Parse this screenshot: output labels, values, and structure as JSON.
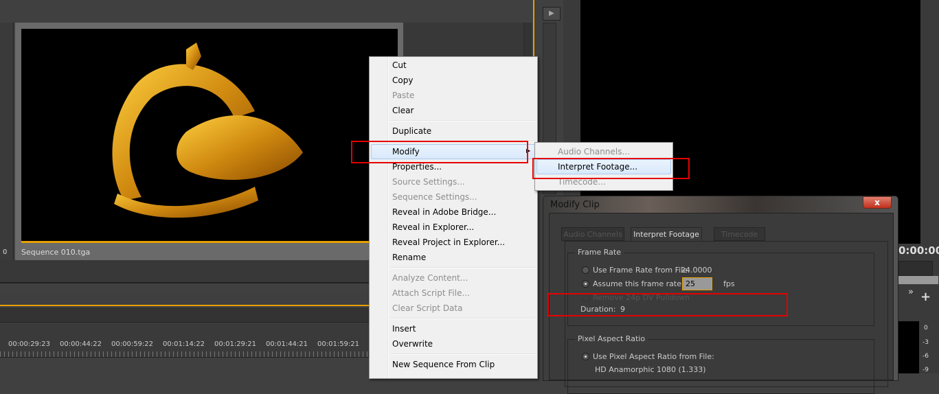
{
  "preview": {
    "clip_name": "Sequence 010.tga",
    "left_counter": "0"
  },
  "timeline": {
    "timecodes": [
      "00:00:29:23",
      "00:00:44:22",
      "00:00:59:22",
      "00:01:14:22",
      "00:01:29:21",
      "00:01:44:21",
      "00:01:59:21"
    ]
  },
  "program_monitor": {
    "timecode": "0:00:00",
    "meter_ticks": [
      "0",
      "-3",
      "-6",
      "-9"
    ]
  },
  "context_menu": {
    "items": [
      {
        "label": "Cut",
        "enabled": true
      },
      {
        "label": "Copy",
        "enabled": true
      },
      {
        "label": "Paste",
        "enabled": false
      },
      {
        "label": "Clear",
        "enabled": true
      },
      {
        "label": "Duplicate",
        "enabled": true
      },
      {
        "label": "Modify",
        "enabled": true,
        "submenu": true,
        "highlighted": true
      },
      {
        "label": "Properties...",
        "enabled": true
      },
      {
        "label": "Source Settings...",
        "enabled": false
      },
      {
        "label": "Sequence Settings...",
        "enabled": false
      },
      {
        "label": "Reveal in Adobe Bridge...",
        "enabled": true
      },
      {
        "label": "Reveal in Explorer...",
        "enabled": true
      },
      {
        "label": "Reveal Project in Explorer...",
        "enabled": true
      },
      {
        "label": "Rename",
        "enabled": true
      },
      {
        "label": "Analyze Content...",
        "enabled": false
      },
      {
        "label": "Attach Script File...",
        "enabled": false
      },
      {
        "label": "Clear Script Data",
        "enabled": false
      },
      {
        "label": "Insert",
        "enabled": true
      },
      {
        "label": "Overwrite",
        "enabled": true
      },
      {
        "label": "New Sequence From Clip",
        "enabled": true
      }
    ]
  },
  "submenu": {
    "items": [
      {
        "label": "Audio Channels...",
        "enabled": false
      },
      {
        "label": "Interpret Footage...",
        "enabled": true,
        "highlighted": true
      },
      {
        "label": "Timecode...",
        "enabled": false
      }
    ]
  },
  "dialog": {
    "title": "Modify Clip",
    "close": "x",
    "tabs": [
      "Audio Channels",
      "Interpret Footage",
      "Timecode"
    ],
    "active_tab": "Interpret Footage",
    "frame_rate": {
      "title": "Frame Rate",
      "use_file": "Use Frame Rate from File:",
      "file_rate": "24.0000",
      "assume": "Assume this frame rate:",
      "assume_value": "25",
      "unit": "fps",
      "pulldown": "Remove 24p DV Pulldown",
      "duration_label": "Duration:",
      "duration": "9"
    },
    "pixel_aspect": {
      "title": "Pixel Aspect Ratio",
      "use_file": "Use Pixel Aspect Ratio from File:",
      "file_value": "HD Anamorphic 1080 (1.333)"
    }
  },
  "colors": {
    "accent": "#e8a000",
    "highlight_box": "#e60000"
  }
}
